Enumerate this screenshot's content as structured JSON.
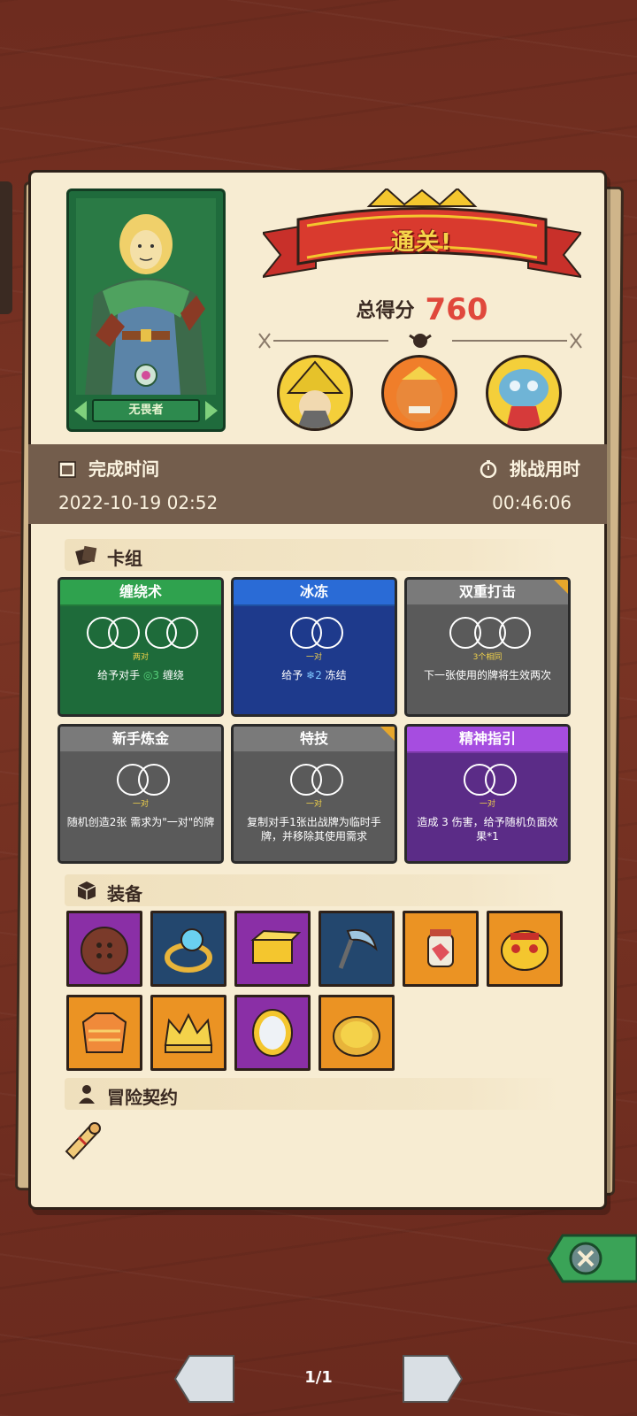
{
  "result": {
    "banner": "通关!",
    "score_label": "总得分",
    "score_value": "760"
  },
  "hero": {
    "name": "无畏者"
  },
  "time": {
    "complete_label": "完成时间",
    "complete_value": "2022-10-19 02:52",
    "duration_label": "挑战用时",
    "duration_value": "00:46:06"
  },
  "sections": {
    "deck": "卡组",
    "equipment": "装备",
    "contract": "冒险契约"
  },
  "cards": [
    {
      "title": "缠绕术",
      "req": "两对",
      "desc_pre": "给予对手",
      "desc_num": "3",
      "desc_post": "缠绕",
      "color": "#1e6b3a",
      "title_color": "#2fa24e"
    },
    {
      "title": "冰冻",
      "req": "一对",
      "desc_pre": "给予",
      "desc_num": "2",
      "desc_post": "冻结",
      "color": "#1e3a8c",
      "title_color": "#2a6bd6"
    },
    {
      "title": "双重打击",
      "req": "3个相同",
      "desc": "下一张使用的牌将生效两次",
      "color": "#5a5a5a",
      "title_color": "#7a7a7a"
    },
    {
      "title": "新手炼金",
      "req": "一对",
      "desc": "随机创造2张 需求为\"一对\"的牌",
      "color": "#5a5a5a",
      "title_color": "#7a7a7a"
    },
    {
      "title": "特技",
      "req": "一对",
      "desc": "复制对手1张出战牌为临时手牌，并移除其使用需求",
      "color": "#5a5a5a",
      "title_color": "#7a7a7a"
    },
    {
      "title": "精神指引",
      "req": "一对",
      "desc": "造成 3 伤害，给予随机负面效果*1",
      "color": "#5b2c87",
      "title_color": "#a64de0"
    }
  ],
  "equipment": [
    {
      "icon": "button-icon",
      "color": "purple"
    },
    {
      "icon": "ring-icon",
      "color": "navy"
    },
    {
      "icon": "cheese-icon",
      "color": "purple"
    },
    {
      "icon": "scythe-icon",
      "color": "navy"
    },
    {
      "icon": "jar-icon",
      "color": "orange"
    },
    {
      "icon": "mask-icon",
      "color": "orange"
    },
    {
      "icon": "sweater-icon",
      "color": "orange"
    },
    {
      "icon": "crown-icon",
      "color": "orange"
    },
    {
      "icon": "mirror-icon",
      "color": "purple"
    },
    {
      "icon": "coin-icon",
      "color": "orange"
    }
  ],
  "pagination": "1/1"
}
